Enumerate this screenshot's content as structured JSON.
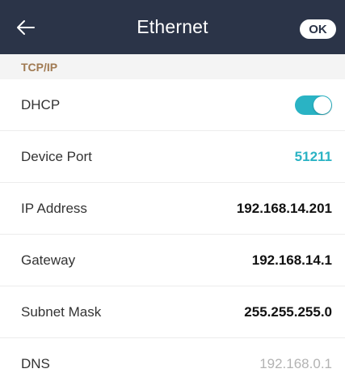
{
  "header": {
    "back_icon": "arrow-left-icon",
    "title": "Ethernet",
    "ok_label": "OK"
  },
  "section": {
    "title": "TCP/IP"
  },
  "rows": {
    "dhcp": {
      "label": "DHCP",
      "enabled": true
    },
    "device_port": {
      "label": "Device Port",
      "value": "51211"
    },
    "ip_address": {
      "label": "IP Address",
      "value": "192.168.14.201"
    },
    "gateway": {
      "label": "Gateway",
      "value": "192.168.14.1"
    },
    "subnet_mask": {
      "label": "Subnet Mask",
      "value": "255.255.255.0"
    },
    "dns": {
      "label": "DNS",
      "value": "192.168.0.1"
    }
  },
  "colors": {
    "header_bg": "#2b3448",
    "accent": "#2ab3c4",
    "section_title": "#a07a52"
  }
}
